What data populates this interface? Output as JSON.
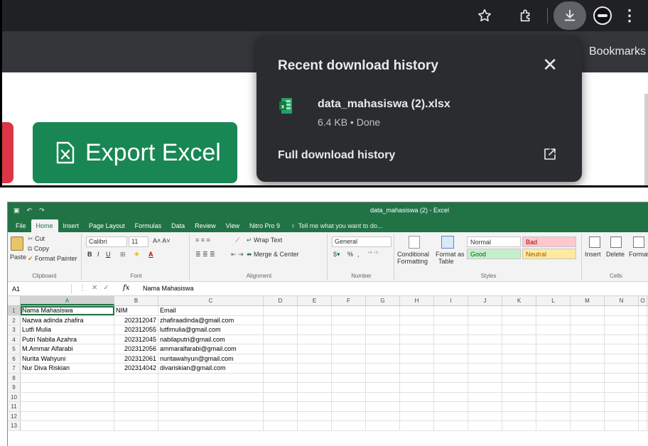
{
  "browser": {
    "bookmarks_label": "Bookmarks",
    "export_button_label": "Export Excel",
    "colors": {
      "toolbar": "#202124",
      "popup": "#2b2c30",
      "export": "#198754",
      "danger": "#dc3545"
    },
    "download_popup": {
      "title": "Recent download history",
      "file_name": "data_mahasiswa (2).xlsx",
      "file_status": "6.4 KB • Done",
      "full_history_label": "Full download history"
    },
    "icons": [
      "star-icon",
      "extensions-icon",
      "download-icon",
      "avatar",
      "more-vert-icon",
      "close-icon",
      "excel-file-icon",
      "open-in-new-icon",
      "excel-icon"
    ]
  },
  "excel": {
    "doc_title": "data_mahasiswa (2) - Excel",
    "accent": "#217346",
    "tabs": [
      "File",
      "Home",
      "Insert",
      "Page Layout",
      "Formulas",
      "Data",
      "Review",
      "View",
      "Nitro Pro 9"
    ],
    "active_tab": "Home",
    "tell_me": "Tell me what you want to do...",
    "ribbon": {
      "clipboard": {
        "paste": "Paste",
        "cut": "Cut",
        "copy": "Copy",
        "format_painter": "Format Painter",
        "label": "Clipboard"
      },
      "font": {
        "name": "Calibri",
        "size": "11",
        "label": "Font"
      },
      "alignment": {
        "wrap_text": "Wrap Text",
        "merge_center": "Merge & Center",
        "label": "Alignment"
      },
      "number": {
        "format": "General",
        "percent": "%",
        "comma": ",",
        "label": "Number"
      },
      "styles": {
        "conditional_formatting_1": "Conditional",
        "conditional_formatting_2": "Formatting",
        "format_as_table_1": "Format as",
        "format_as_table_2": "Table",
        "normal": "Normal",
        "bad": "Bad",
        "good": "Good",
        "neutral": "Neutral",
        "label": "Styles"
      },
      "cells": {
        "insert": "Insert",
        "delete": "Delete",
        "format": "Format",
        "label": "Cells"
      }
    },
    "name_box": "A1",
    "formula_value": "Nama Mahasiswa",
    "columns": [
      "A",
      "B",
      "C",
      "D",
      "E",
      "F",
      "G",
      "H",
      "I",
      "J",
      "K",
      "L",
      "M",
      "N",
      "O"
    ],
    "rows": [
      {
        "n": "1",
        "a": "Nama Mahasiswa",
        "b": "NIM",
        "c": "Email"
      },
      {
        "n": "2",
        "a": "Nazwa adinda zhafira",
        "b": "202312047",
        "c": "zhafiraadinda@gmail.com"
      },
      {
        "n": "3",
        "a": "Lutfi Mulia",
        "b": "202312055",
        "c": "lutfimulia@gmail.com"
      },
      {
        "n": "4",
        "a": "Putri Nabila Azahra",
        "b": "202312045",
        "c": "nabilaputri@gmail.com"
      },
      {
        "n": "5",
        "a": "M.Ammar Alfarabi",
        "b": "202312056",
        "c": "ammaralfarabi@gmail.com"
      },
      {
        "n": "6",
        "a": "Nurita Wahyuni",
        "b": "202312061",
        "c": "nuritawahyun@gmail.com"
      },
      {
        "n": "7",
        "a": "Nur Diva Riskian",
        "b": "202314042",
        "c": "divariskian@gmail.com"
      },
      {
        "n": "8",
        "a": "",
        "b": "",
        "c": ""
      },
      {
        "n": "9",
        "a": "",
        "b": "",
        "c": ""
      },
      {
        "n": "10",
        "a": "",
        "b": "",
        "c": ""
      },
      {
        "n": "11",
        "a": "",
        "b": "",
        "c": ""
      },
      {
        "n": "12",
        "a": "",
        "b": "",
        "c": ""
      },
      {
        "n": "13",
        "a": "",
        "b": "",
        "c": ""
      }
    ]
  }
}
